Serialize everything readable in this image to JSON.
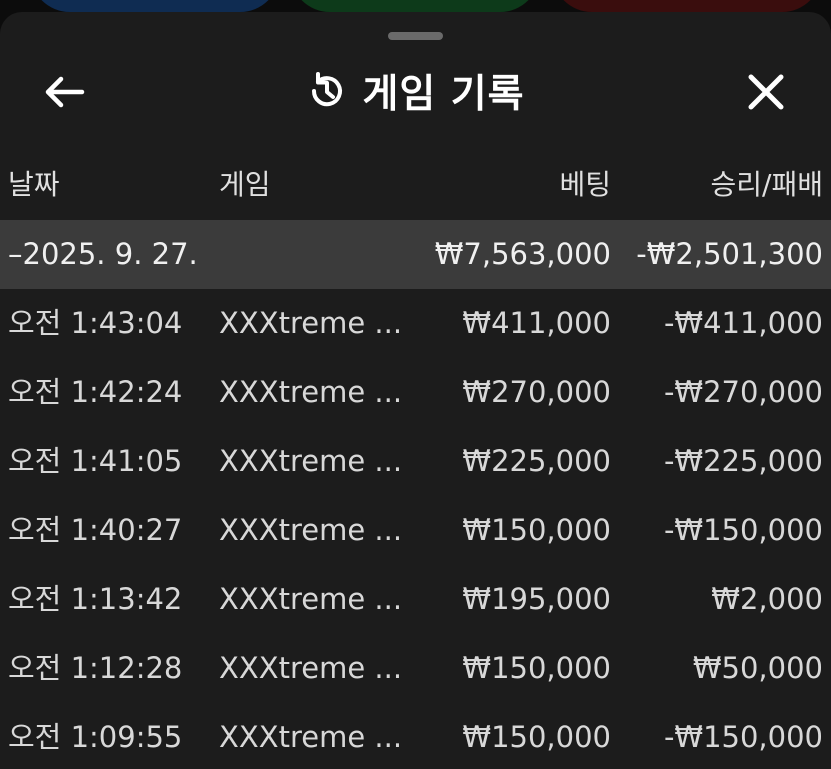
{
  "header": {
    "title": "게임 기록"
  },
  "columns": {
    "date": "날짜",
    "game": "게임",
    "bet": "베팅",
    "result": "승리/패배"
  },
  "group": {
    "toggle_date": "–2025. 9. 27.",
    "bet_total": "₩7,563,000",
    "result_total": "-₩2,501,300"
  },
  "rows": [
    {
      "time": "오전 1:43:04",
      "game": "XXXtreme ...",
      "bet": "₩411,000",
      "result": "-₩411,000"
    },
    {
      "time": "오전 1:42:24",
      "game": "XXXtreme ...",
      "bet": "₩270,000",
      "result": "-₩270,000"
    },
    {
      "time": "오전 1:41:05",
      "game": "XXXtreme ...",
      "bet": "₩225,000",
      "result": "-₩225,000"
    },
    {
      "time": "오전 1:40:27",
      "game": "XXXtreme ...",
      "bet": "₩150,000",
      "result": "-₩150,000"
    },
    {
      "time": "오전 1:13:42",
      "game": "XXXtreme ...",
      "bet": "₩195,000",
      "result": "₩2,000"
    },
    {
      "time": "오전 1:12:28",
      "game": "XXXtreme ...",
      "bet": "₩150,000",
      "result": "₩50,000"
    },
    {
      "time": "오전 1:09:55",
      "game": "XXXtreme ...",
      "bet": "₩150,000",
      "result": "-₩150,000"
    }
  ],
  "icons": {
    "back": "arrow-left-icon",
    "history": "history-icon",
    "close": "close-icon"
  }
}
